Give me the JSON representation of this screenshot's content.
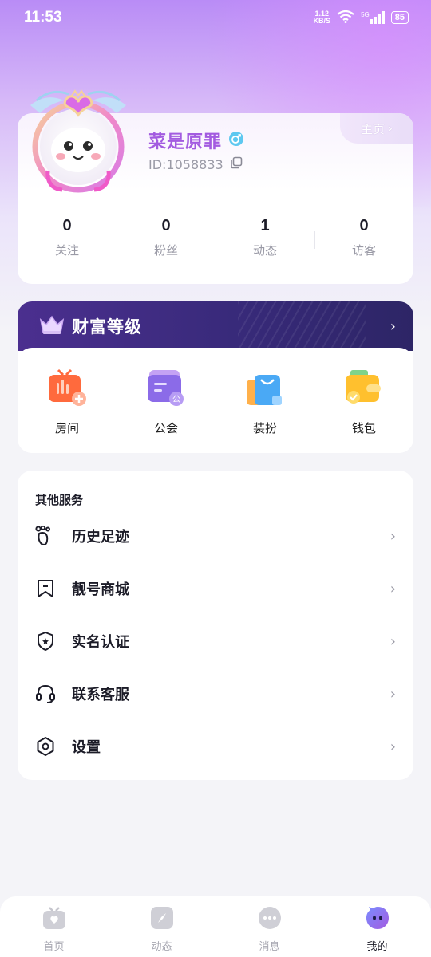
{
  "status_bar": {
    "time": "11:53",
    "net_speed_value": "1.12",
    "net_speed_unit": "KB/S",
    "signal_label": "5G",
    "battery": "85"
  },
  "profile": {
    "home_label": "主页",
    "nickname": "菜是原罪",
    "user_id": "ID:1058833",
    "stats": [
      {
        "value": "0",
        "label": "关注"
      },
      {
        "value": "0",
        "label": "粉丝"
      },
      {
        "value": "1",
        "label": "动态"
      },
      {
        "value": "0",
        "label": "访客"
      }
    ]
  },
  "wealth": {
    "title": "财富等级",
    "features": [
      {
        "label": "房间",
        "icon": "room-icon"
      },
      {
        "label": "公会",
        "icon": "guild-icon"
      },
      {
        "label": "装扮",
        "icon": "dress-up-icon"
      },
      {
        "label": "钱包",
        "icon": "wallet-icon"
      }
    ]
  },
  "services": {
    "title": "其他服务",
    "items": [
      {
        "label": "历史足迹",
        "icon": "footprint-icon"
      },
      {
        "label": "靓号商城",
        "icon": "bookmark-icon"
      },
      {
        "label": "实名认证",
        "icon": "shield-icon"
      },
      {
        "label": "联系客服",
        "icon": "headset-icon"
      },
      {
        "label": "设置",
        "icon": "settings-icon"
      }
    ]
  },
  "tabbar": {
    "tabs": [
      {
        "label": "首页",
        "icon": "home-tv-icon",
        "active": false
      },
      {
        "label": "动态",
        "icon": "compass-icon",
        "active": false
      },
      {
        "label": "消息",
        "icon": "chat-icon",
        "active": false
      },
      {
        "label": "我的",
        "icon": "me-icon",
        "active": true
      }
    ]
  },
  "colors": {
    "accent": "#a35be0",
    "wealth_header": "#3b2a80",
    "background": "#f4f4f8"
  }
}
